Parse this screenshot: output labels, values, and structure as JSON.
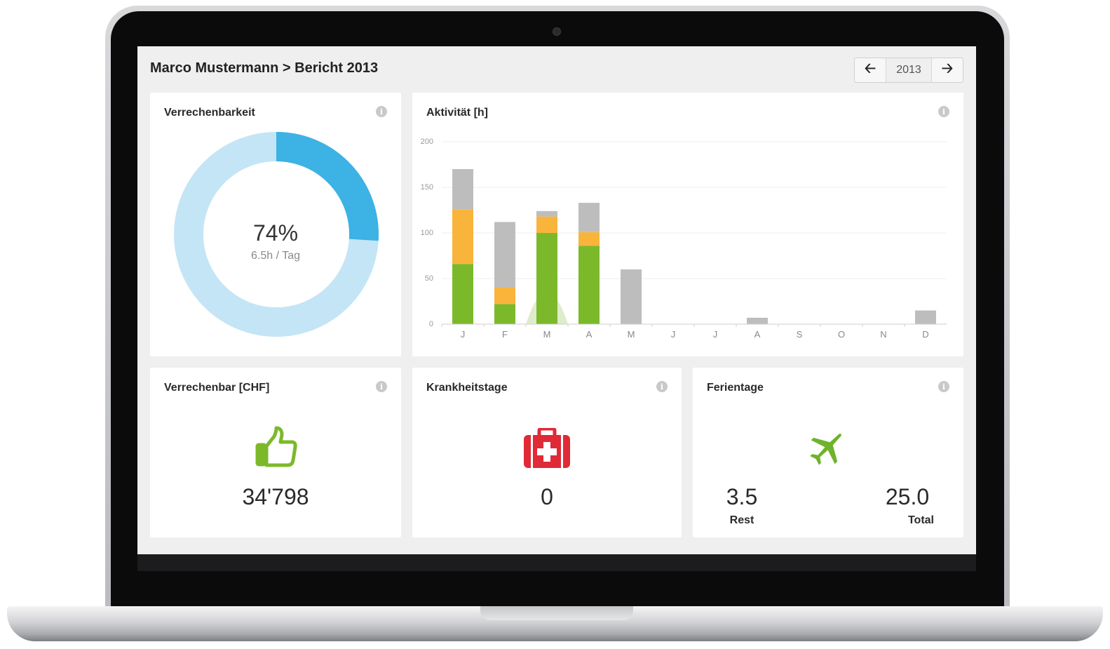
{
  "header": {
    "title": "Marco Mustermann > Bericht 2013",
    "year": "2013",
    "prev_icon": "arrow-left-icon",
    "next_icon": "arrow-right-icon"
  },
  "info_glyph": "i",
  "verrechenbarkeit": {
    "title": "Verrechenbarkeit",
    "percent_label": "74%",
    "sub_label": "6.5h / Tag",
    "percent": 0.26,
    "colors": {
      "filled": "#3db2e4",
      "track": "#c4e5f5"
    }
  },
  "aktivitaet": {
    "title": "Aktivität [h]"
  },
  "chart_data": {
    "type": "bar",
    "stacked": true,
    "categories": [
      "J",
      "F",
      "M",
      "A",
      "M",
      "J",
      "J",
      "A",
      "S",
      "O",
      "N",
      "D"
    ],
    "y_ticks": [
      "0",
      "50",
      "100",
      "150",
      "200"
    ],
    "ylim": [
      0,
      200
    ],
    "series": [
      {
        "color": "#7cb92a",
        "values": [
          66,
          22,
          100,
          86,
          0,
          0,
          0,
          0,
          0,
          0,
          0,
          0
        ]
      },
      {
        "color": "#f9b43c",
        "values": [
          60,
          18,
          18,
          15,
          0,
          0,
          0,
          0,
          0,
          0,
          0,
          0
        ]
      },
      {
        "color": "#bdbdbd",
        "values": [
          44,
          72,
          6,
          32,
          60,
          0,
          0,
          7,
          0,
          0,
          0,
          15
        ]
      }
    ],
    "overlay_area": {
      "color": "#dfeccc",
      "x_start": 1.5,
      "x_peak": 2,
      "x_end": 2.5,
      "peak": 35
    },
    "grid": true,
    "legend": "none"
  },
  "verrechenbar": {
    "title": "Verrechenbar [CHF]",
    "value": "34'798",
    "icon": "thumbs-up-icon",
    "icon_color": "#7cb92a"
  },
  "krankheitstage": {
    "title": "Krankheitstage",
    "value": "0",
    "icon": "first-aid-kit-icon",
    "icon_color": "#e02a36"
  },
  "ferientage": {
    "title": "Ferientage",
    "rest_value": "3.5",
    "rest_label": "Rest",
    "total_value": "25.0",
    "total_label": "Total",
    "icon": "airplane-icon",
    "icon_color": "#6fb22c"
  }
}
